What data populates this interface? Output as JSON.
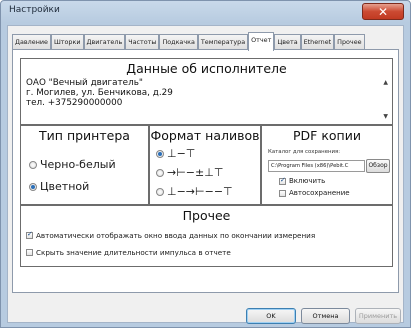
{
  "window": {
    "title": "Настройки"
  },
  "tabs": [
    {
      "label": "Давление",
      "active": false
    },
    {
      "label": "Шторки",
      "active": false
    },
    {
      "label": "Двигатель",
      "active": false
    },
    {
      "label": "Частоты",
      "active": false
    },
    {
      "label": "Подкачка",
      "active": false
    },
    {
      "label": "Температура",
      "active": false
    },
    {
      "label": "Отчет",
      "active": true
    },
    {
      "label": "Цвета",
      "active": false
    },
    {
      "label": "Ethernet",
      "active": false
    },
    {
      "label": "Прочее",
      "active": false
    }
  ],
  "executor": {
    "title": "Данные об исполнителе",
    "text": "ОАО \"Вечный двигатель\"\nг. Могилев, ул. Бенчикова, д.29\nтел. +375290000000"
  },
  "printer": {
    "title": "Тип принтера",
    "options": [
      {
        "label": "Черно-белый",
        "checked": false
      },
      {
        "label": "Цветной",
        "checked": true
      }
    ]
  },
  "format": {
    "title": "Формат наливов",
    "options": [
      {
        "symbol": "⊥−⊤",
        "checked": true
      },
      {
        "symbol": "→⊢−±⊥⊤",
        "checked": false
      },
      {
        "symbol": "⊥−→⊢−−⊤",
        "checked": false
      }
    ]
  },
  "pdf": {
    "title": "PDF копии",
    "catalog_label": "Каталог для сохранения:",
    "path_value": "C:\\Program Files (x86)\\Pebit.C",
    "browse_label": "Обзор",
    "enable_label": "Включить",
    "enable_checked": true,
    "autosave_label": "Автосохранение",
    "autosave_checked": false
  },
  "other": {
    "title": "Прочее",
    "auto_show_label": "Автоматически отображать окно ввода данных по окончании измерения",
    "auto_show_checked": true,
    "hide_pulse_label": "Скрыть значение длительности импульса в отчете",
    "hide_pulse_checked": false
  },
  "buttons": {
    "ok": "OK",
    "cancel": "Отмена",
    "apply": "Применить"
  }
}
